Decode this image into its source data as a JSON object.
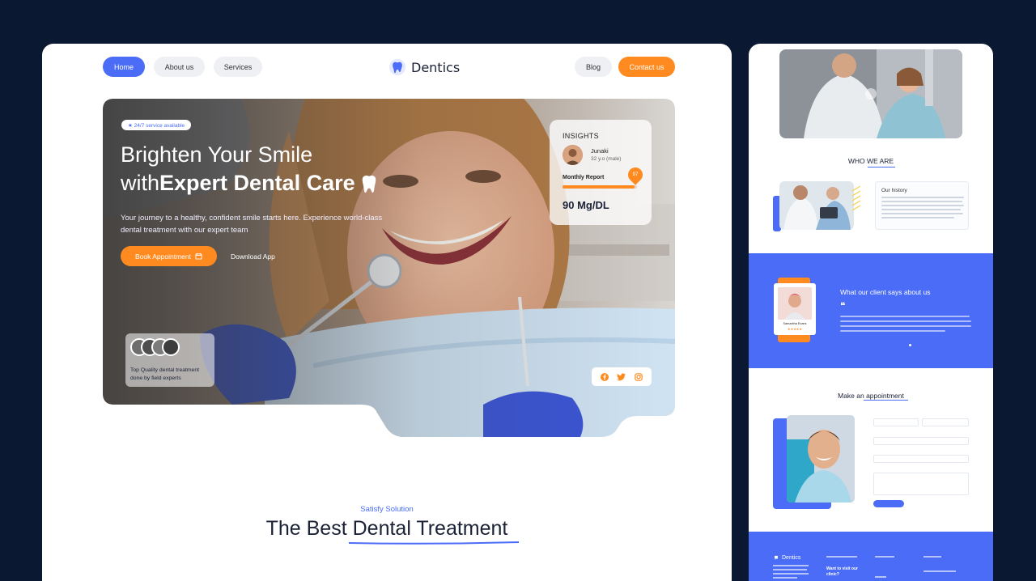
{
  "nav": {
    "home": "Home",
    "about": "About us",
    "services": "Services",
    "brand": "Dentics",
    "blog": "Blog",
    "contact": "Contact us"
  },
  "hero": {
    "badge": "★ 24/7 service available",
    "title_line1": "Brighten Your Smile",
    "title_line2_prefix": "with",
    "title_line2_bold": "Expert Dental Care",
    "subtitle": "Your journey to a healthy, confident smile starts here. Experience world-class dental treatment with our expert team",
    "book_button": "Book Appointment",
    "download_button": "Download App"
  },
  "insights": {
    "title": "INSIGHTS",
    "name": "Junaki",
    "age": "32 y.o (male)",
    "report_label": "Monthly Report",
    "report_badge": "97",
    "progress_fraction": 0.97,
    "value": "90 Mg/DL"
  },
  "experts": {
    "text": "Top Quality dental treatment done by field experts"
  },
  "social": {
    "icons": [
      "facebook-icon",
      "twitter-icon",
      "instagram-icon"
    ]
  },
  "section": {
    "kicker": "Satisfy Solution",
    "heading_prefix": "The Best ",
    "heading_highlight": "Dental Treatment"
  },
  "side": {
    "who_prefix": "WHO ",
    "who_highlight": "WE ARE",
    "history_title": "Our history",
    "testimonial_title": "What our client says about us",
    "testimonial_name": "Samantha Evans",
    "appointment_prefix": "Make an ",
    "appointment_highlight": "appointment",
    "footer_brand": "Dentics",
    "footer_visit": "Want to visit our clinic?"
  },
  "colors": {
    "primary": "#4a6cf7",
    "accent": "#ff8a1f",
    "background": "#0b1831",
    "heading": "#1b2236"
  }
}
